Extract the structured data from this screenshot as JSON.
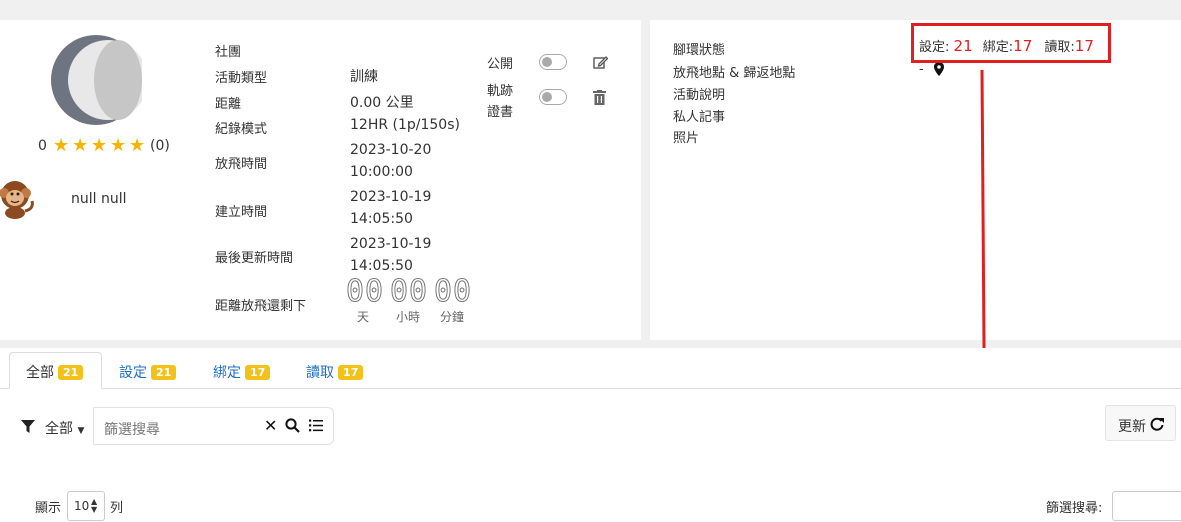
{
  "left_panel": {
    "rating_value": "0",
    "rating_count": "(0)",
    "user_name": "null null"
  },
  "details": {
    "club_label": "社團",
    "activity_type_label": "活動類型",
    "activity_type_value": "訓練",
    "distance_label": "距離",
    "distance_value": "0.00 公里",
    "record_mode_label": "紀錄模式",
    "record_mode_value": "12HR (1p/150s)",
    "release_time_label": "放飛時間",
    "release_time_date": "2023-10-20",
    "release_time_time": "10:00:00",
    "created_label": "建立時間",
    "created_date": "2023-10-19",
    "created_time": "14:05:50",
    "updated_label": "最後更新時間",
    "updated_date": "2023-10-19",
    "updated_time": "14:05:50",
    "countdown_label": "距離放飛還剩下",
    "countdown_days": "00",
    "countdown_hours": "00",
    "countdown_minutes": "00",
    "unit_days": "天",
    "unit_hours": "小時",
    "unit_minutes": "分鐘",
    "public_label": "公開",
    "track_label_1": "軌跡",
    "track_label_2": "證書"
  },
  "right_panel": {
    "ring_status_label": "腳環狀態",
    "release_return_label": "放飛地點 & 歸返地點",
    "activity_desc_label": "活動說明",
    "private_note_label": "私人記事",
    "photos_label": "照片",
    "location_value": "-",
    "setting_label": "設定:",
    "setting_count": "21",
    "binding_label": "綁定:",
    "binding_count": "17",
    "reading_label": "讀取:",
    "reading_count": "17"
  },
  "tabs": [
    {
      "label": "全部",
      "count": "21"
    },
    {
      "label": "設定",
      "count": "21"
    },
    {
      "label": "綁定",
      "count": "17"
    },
    {
      "label": "讀取",
      "count": "17"
    }
  ],
  "filter": {
    "dropdown_label": "全部",
    "search_placeholder": "篩選搜尋",
    "refresh_label": "更新"
  },
  "footer": {
    "show_label": "顯示",
    "page_size": "10",
    "rows_label": "列",
    "filter_search_label": "篩選搜尋:"
  },
  "colors": {
    "accent_red": "#e02020",
    "badge_yellow": "#f2c21b",
    "link_blue": "#1f6fc5",
    "star_gold": "#f5b400"
  }
}
